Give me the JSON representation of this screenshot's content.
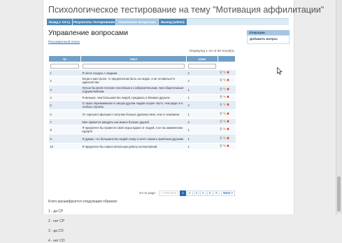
{
  "header": {
    "title": "Психологическое тестирование на тему \"Мотивация аффилитации\""
  },
  "menu": {
    "items": [
      {
        "label": "Назад к тесту"
      },
      {
        "label": "Результаты тестирования"
      },
      {
        "label": "Управление вопросами",
        "active": true
      },
      {
        "label": "Выход (admin)"
      }
    ]
  },
  "main": {
    "title": "Управление вопросами",
    "search_link": "Расширенный поиск",
    "summary": "Displaying 1-10 of 60 result(s).",
    "columns": [
      "№",
      "текст",
      "ключ",
      ""
    ],
    "rows": [
      {
        "num": "1",
        "text": "Я легко сходусь с людьми.",
        "key": "2"
      },
      {
        "num": "2",
        "text": "Когда я расстроен, то предпочитаю быть на людях, а не оставаться в одиночестве.",
        "key": "2"
      },
      {
        "num": "3",
        "text": "Лучше бы меня считали способным и сообразительным, чем общительным и дружелюбным.",
        "key": "1"
      },
      {
        "num": "4",
        "text": "Я меньше, чем большинство людей, нуждаюсь в близких друзьях.",
        "key": "1"
      },
      {
        "num": "5",
        "text": "О своих переживаниях я говорю другим людям скорее часто, чем редко и в особых случаях.",
        "key": "2"
      },
      {
        "num": "6",
        "text": "От хорошего фильма я получаю больше удовольствия, чем от компании.",
        "key": "1"
      },
      {
        "num": "7",
        "text": "Мне нравится заводить как можно больше друзей.",
        "key": "2"
      },
      {
        "num": "8",
        "text": "Я предпочел бы провести свой отдых вдали от людей, а не на оживленном курорте.",
        "key": "1"
      },
      {
        "num": "9",
        "text": "Я думаю, что большинство людей слову и хочет оказать приятным друзьям.",
        "key": "1"
      },
      {
        "num": "10",
        "text": "Я предпочел бы самостоятельную работу коллективной.",
        "key": "1"
      }
    ],
    "pager": {
      "label": "Go to page:",
      "prev": "< Previous",
      "pages": [
        "1",
        "2",
        "3",
        "4",
        "5",
        "6"
      ],
      "current": "1",
      "next": "Next >"
    },
    "keys": {
      "intro": "Ключ расшифруется следующим образом:",
      "lines": [
        "1 - да СР",
        "2 - нет СР",
        "3 - да СО",
        "4 - нет СО"
      ]
    }
  },
  "sidebar": {
    "title": "Операции",
    "operations": [
      "Добавить вопрос"
    ]
  },
  "icons": {
    "view": "magnifier-icon",
    "edit": "pencil-icon",
    "delete": "delete-icon"
  },
  "colors": {
    "menu_bg": "#4c88b9",
    "menu_active": "#a4c6e3",
    "table_header": "#6f9fc8",
    "link": "#2a6ab0"
  }
}
